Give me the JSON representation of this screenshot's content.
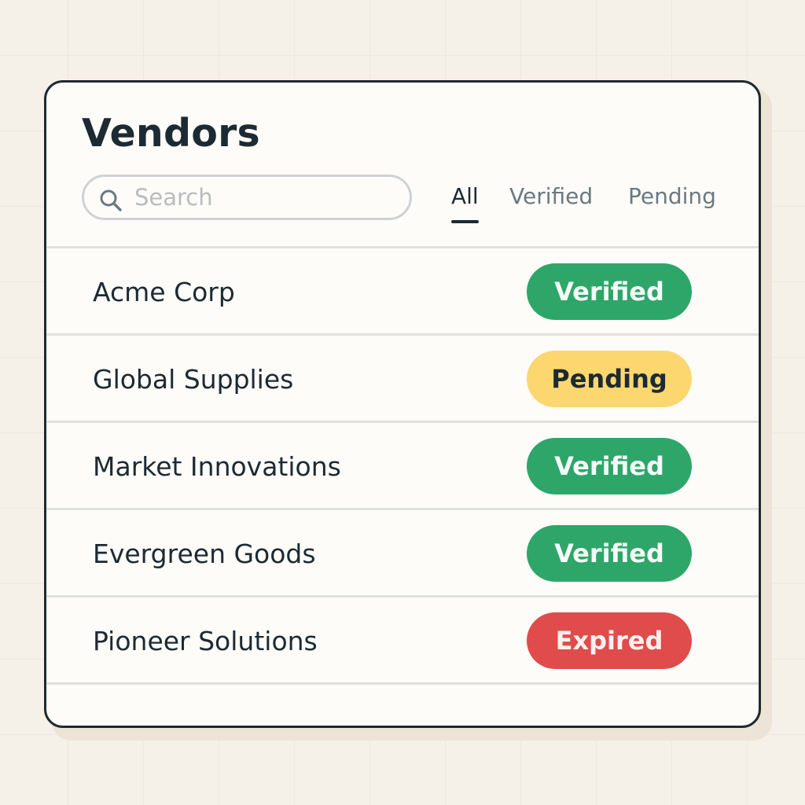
{
  "page": {
    "title": "Vendors"
  },
  "search": {
    "placeholder": "Search",
    "value": ""
  },
  "tabs": [
    {
      "label": "All",
      "active": true
    },
    {
      "label": "Verified",
      "active": false
    },
    {
      "label": "Pending",
      "active": false
    }
  ],
  "vendors": [
    {
      "name": "Acme Corp",
      "status": "Verified"
    },
    {
      "name": "Global Supplies",
      "status": "Pending"
    },
    {
      "name": "Market Innovations",
      "status": "Verified"
    },
    {
      "name": "Evergreen Goods",
      "status": "Verified"
    },
    {
      "name": "Pioneer Solutions",
      "status": "Expired"
    }
  ],
  "colors": {
    "verified": "#2ea66a",
    "pending": "#fcd770",
    "expired": "#e04b4b",
    "text_dark": "#1c2a33",
    "text_muted": "#6a7982"
  }
}
